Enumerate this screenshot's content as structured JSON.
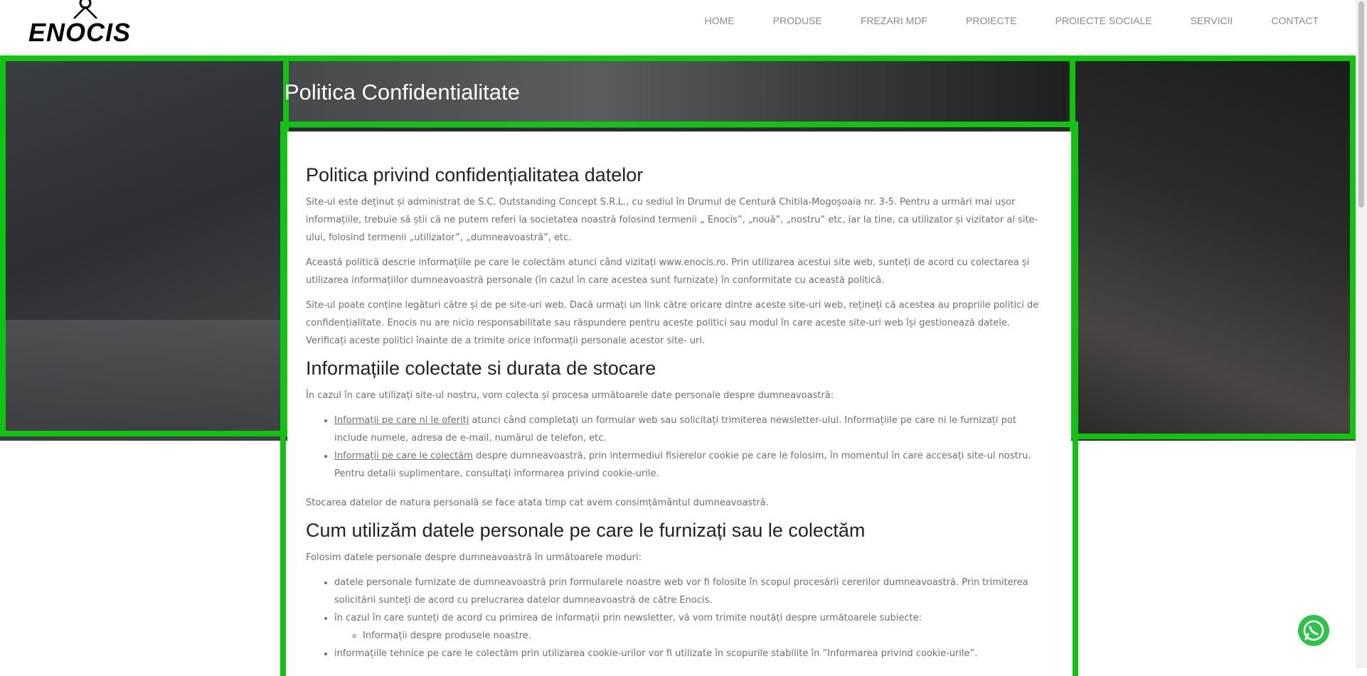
{
  "logo": {
    "text": "ENOCIS"
  },
  "nav": [
    "HOME",
    "PRODUSE",
    "FREZARI MDF",
    "PROIECTE",
    "PROIECTE SOCIALE",
    "SERVICII",
    "CONTACT"
  ],
  "page_title": "Politica Confidentialitate",
  "sections": {
    "s1_title": "Politica privind confidențialitatea datelor",
    "s1_p1": "Site-ul este deținut și administrat de S.C. Outstanding Concept S.R.L., cu sediul în Drumul de Centură Chitila-Mogoșoaia nr. 3-5. Pentru a urmări mai ușor informațiile, trebuie să știi că ne putem referi la societatea noastră folosind termenii „ Enocis”, „nouă”, „nostru” etc, iar la tine, ca utilizator și vizitator al site-ului, folosind termenii „utilizator”, „dumneavoastră”, etc.",
    "s1_p2": "Această politică descrie informațiile pe care le colectăm atunci când vizitați www.enocis.ro. Prin utilizarea acestui site web, sunteți de acord cu colectarea și utilizarea informațiilor dumneavoastră personale (în cazul în care acestea sunt furnizate) în conformitate cu această politică.",
    "s1_p3": "Site-ul poate conține legături către și de pe site-uri web. Dacă urmați un link către oricare dintre aceste site-uri web, rețineți că acestea au propriile politici de confidențialitate. Enocis nu are nicio responsabilitate sau răspundere pentru aceste politici sau modul în care aceste site-uri web își gestionează datele. Verificați aceste politici înainte de a trimite orice informații personale acestor site- uri.",
    "s2_title": "Informațiile colectate si durata de stocare",
    "s2_p1": "În cazul în care utilizați site-ul nostru, vom colecta și procesa următoarele date personale despre dumneavoastră:",
    "s2_li1_link": "Informații pe care ni le oferiți",
    "s2_li1_text": " atunci când completați un formular web sau solicitați trimiterea newsletter-ului. Informațiile pe care ni le furnizați pot include numele, adresa de e-mail, numărul de telefon, etc.",
    "s2_li2_link": "Informații pe care le colectăm",
    "s2_li2_text": " despre dumneavoastră, prin intermediul fisierelor cookie pe care le folosim, în momentul în care accesați site-ul nostru. Pentru detalii suplimentare, consultați informarea privind cookie-urile.",
    "s2_p2": "Stocarea datelor de natura personală se face atata timp cat avem consimțământul dumneavoastră.",
    "s3_title": "Cum utilizăm datele personale pe care le furnizați sau le colectăm",
    "s3_p1": "Folosim datele personale despre dumneavoastră în următoarele moduri:",
    "s3_li1": "datele personale furnizate de dumneavoastră prin formularele noastre web vor fi folosite în scopul procesării cererilor dumneavoastră. Prin trimiterea solicitării sunteți de acord cu prelucrarea datelor dumneavoastră de către Enocis.",
    "s3_li2": "în cazul în care sunteți de acord cu primirea de informații prin newsletter, vă vom trimite noutăți despre următoarele subiecte:",
    "s3_li2_sub": "Informații despre produsele noastre.",
    "s3_li3": "informațiile tehnice pe care le colectăm prin utilizarea cookie-urilor vor fi utilizate în scopurile stabilite în ”Informarea privind cookie-urile”."
  },
  "colors": {
    "highlight": "#12c312",
    "whatsapp": "#2fc24b"
  }
}
